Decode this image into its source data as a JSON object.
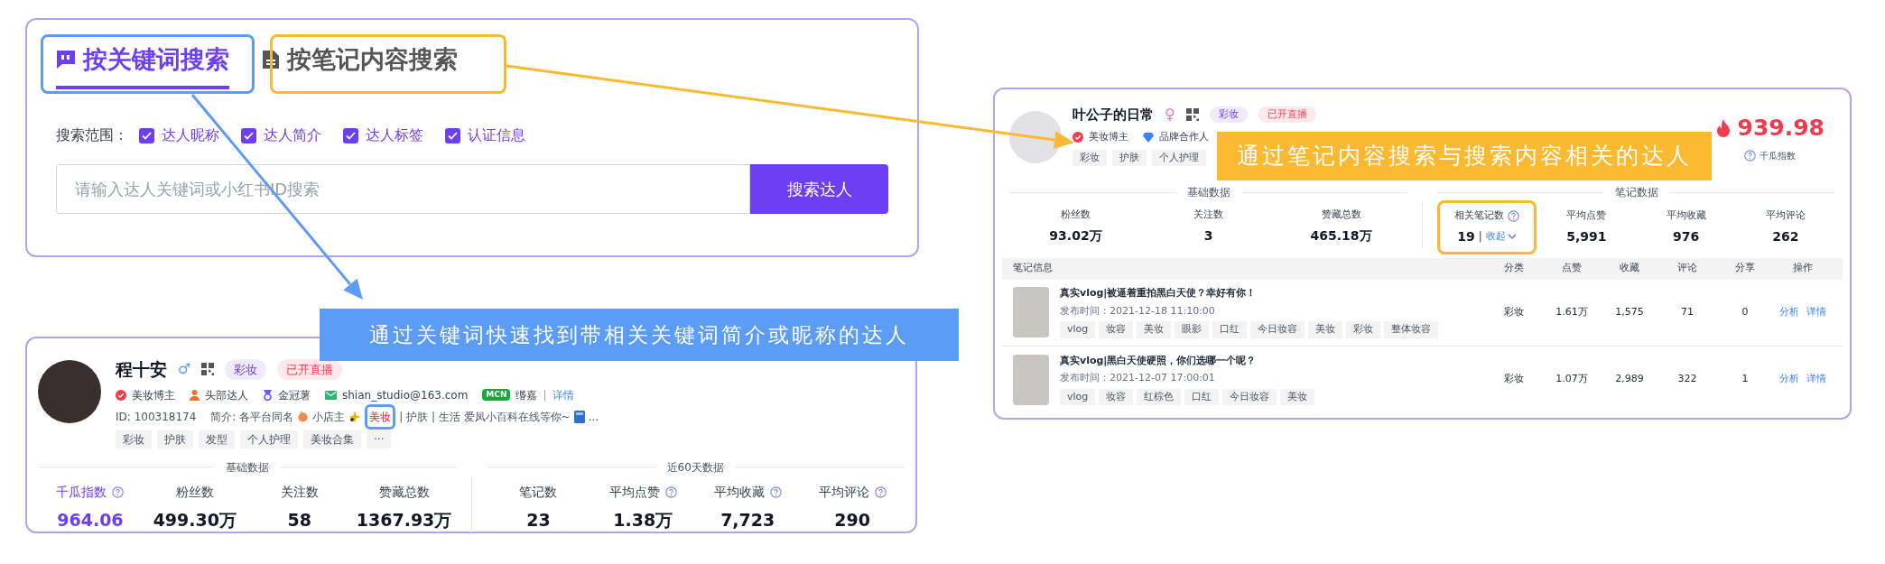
{
  "keyword_panel": {
    "tabs": [
      {
        "label": "按关键词搜索",
        "selected": true
      },
      {
        "label": "按笔记内容搜索",
        "selected": false
      }
    ],
    "scope": {
      "label": "搜索范围：",
      "options": [
        {
          "label": "达人昵称",
          "checked": true
        },
        {
          "label": "达人简介",
          "checked": true
        },
        {
          "label": "达人标签",
          "checked": true
        },
        {
          "label": "认证信息",
          "checked": true
        }
      ]
    },
    "search": {
      "placeholder": "请输入达人关键词或小红书ID搜索",
      "button": "搜索达人"
    }
  },
  "callouts": [
    {
      "text": "通过关键词快速找到带相关关键词简介或昵称的达人",
      "color": "#5b9cf6"
    },
    {
      "text": "通过笔记内容搜索与搜索内容相关的达人",
      "color": "#fbb931"
    }
  ],
  "keyword_result": {
    "name": "程十安",
    "gender_symbol": "♂",
    "labels": [
      {
        "text": "彩妆",
        "kind": "category"
      },
      {
        "text": "已开直播",
        "kind": "live"
      }
    ],
    "badges": [
      {
        "kind": "blogger",
        "text": "美妆博主"
      },
      {
        "kind": "top",
        "text": "头部达人"
      },
      {
        "kind": "crown",
        "text": "金冠薯"
      },
      {
        "kind": "email",
        "text": "shian_studio@163.com"
      }
    ],
    "mcn": {
      "badge": "MCN",
      "name": "缗嘉",
      "separator": "|",
      "link": "详情"
    },
    "id": "ID: 100318174",
    "bio": [
      {
        "kind": "text",
        "text": "简介: 各平台同名"
      },
      {
        "kind": "peach"
      },
      {
        "kind": "text",
        "text": "小店主"
      },
      {
        "kind": "sparkle"
      },
      {
        "kind": "keyword",
        "text": "美妆"
      },
      {
        "kind": "text",
        "text": "| 护肤 | 生活 爱凤小百科在线等你~"
      },
      {
        "kind": "book"
      },
      {
        "kind": "text",
        "text": "..."
      }
    ],
    "tags": [
      "彩妆",
      "护肤",
      "发型",
      "个人护理",
      "美妆合集",
      "···"
    ],
    "sections": [
      "基础数据",
      "近60天数据"
    ],
    "basic_stats": [
      {
        "label": "千瓜指数",
        "value": "964.06",
        "accent": true,
        "help": true
      },
      {
        "label": "粉丝数",
        "value": "499.30万",
        "accent": false,
        "help": false
      },
      {
        "label": "关注数",
        "value": "58",
        "accent": false,
        "help": false
      },
      {
        "label": "赞藏总数",
        "value": "1367.93万",
        "accent": false,
        "help": false
      }
    ],
    "recent_stats": [
      {
        "label": "笔记数",
        "value": "23",
        "accent": false,
        "help": false
      },
      {
        "label": "平均点赞",
        "value": "1.38万",
        "accent": false,
        "help": true
      },
      {
        "label": "平均收藏",
        "value": "7,723",
        "accent": false,
        "help": true
      },
      {
        "label": "平均评论",
        "value": "290",
        "accent": false,
        "help": true
      }
    ]
  },
  "note_result": {
    "name": "叶公子的日常",
    "gender_symbol": "♀",
    "labels": [
      {
        "text": "彩妆",
        "kind": "category"
      },
      {
        "text": "已开直播",
        "kind": "live"
      }
    ],
    "badges": [
      {
        "kind": "blogger",
        "text": "美妆博主"
      },
      {
        "kind": "brand",
        "text": "品牌合作人"
      }
    ],
    "tags": [
      "彩妆",
      "护肤",
      "个人护理"
    ],
    "score": "939.98",
    "score_label": "千瓜指数",
    "sections": [
      "基础数据",
      "笔记数据"
    ],
    "basic_stats": [
      {
        "label": "粉丝数",
        "value": "93.02万",
        "help": false
      },
      {
        "label": "关注数",
        "value": "3",
        "help": false
      },
      {
        "label": "赞藏总数",
        "value": "465.18万",
        "help": false
      }
    ],
    "note_stats": [
      {
        "label": "相关笔记数",
        "value": "19",
        "help": true,
        "highlighted": true,
        "separator": "|",
        "toggle": "收起"
      },
      {
        "label": "平均点赞",
        "value": "5,991",
        "help": false,
        "highlighted": false
      },
      {
        "label": "平均收藏",
        "value": "976",
        "help": false,
        "highlighted": false
      },
      {
        "label": "平均评论",
        "value": "262",
        "help": false,
        "highlighted": false
      }
    ],
    "table": {
      "columns": [
        "笔记信息",
        "分类",
        "点赞",
        "收藏",
        "评论",
        "分享",
        "操作"
      ],
      "rows": [
        {
          "title": "真实vlog|被逼着重拍黑白天使？幸好有你！",
          "time": "发布时间：2021-12-18 11:10:00",
          "tags": [
            "vlog",
            "妆容",
            "美妆",
            "眼影",
            "口红",
            "今日妆容",
            "美妆",
            "彩妆",
            "整体妆容"
          ],
          "category": "彩妆",
          "likes": "1.61万",
          "saves": "1,575",
          "comments": "71",
          "shares": "0",
          "actions": [
            "分析",
            "详情"
          ]
        },
        {
          "title": "真实vlog|黑白天使硬照，你们选哪一个呢？",
          "time": "发布时间：2021-12-07 17:00:01",
          "tags": [
            "vlog",
            "妆容",
            "红棕色",
            "口红",
            "今日妆容",
            "美妆"
          ],
          "category": "彩妆",
          "likes": "1.07万",
          "saves": "2,989",
          "comments": "322",
          "shares": "1",
          "actions": [
            "分析",
            "详情"
          ]
        }
      ]
    }
  }
}
